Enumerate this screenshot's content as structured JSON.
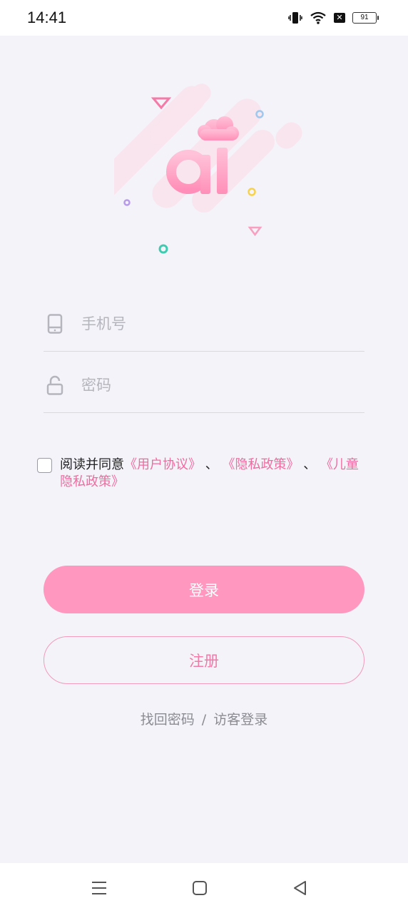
{
  "status_bar": {
    "time": "14:41",
    "battery": "91"
  },
  "login": {
    "phone_placeholder": "手机号",
    "password_placeholder": "密码",
    "agree_prefix": "阅读并同意",
    "user_agreement": "《用户协议》",
    "separator1": "、",
    "privacy_policy": "《隐私政策》",
    "separator2": "、",
    "child_privacy": "《儿童隐私政策》",
    "login_button": "登录",
    "register_button": "注册",
    "forgot_password": "找回密码",
    "slash": "/",
    "guest_login": "访客登录"
  },
  "colors": {
    "accent": "#ff97bf",
    "link": "#f06ba0"
  }
}
